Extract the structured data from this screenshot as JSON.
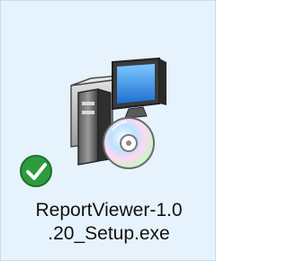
{
  "file": {
    "name_line1": "ReportViewer-1.0",
    "name_line2": ".20_Setup.exe",
    "icon": "installer-package-icon",
    "badge": "check-badge-icon"
  },
  "colors": {
    "selection_fill": "#e7f3fc",
    "selection_border": "#c2def5",
    "badge_green": "#2e9b3f"
  }
}
